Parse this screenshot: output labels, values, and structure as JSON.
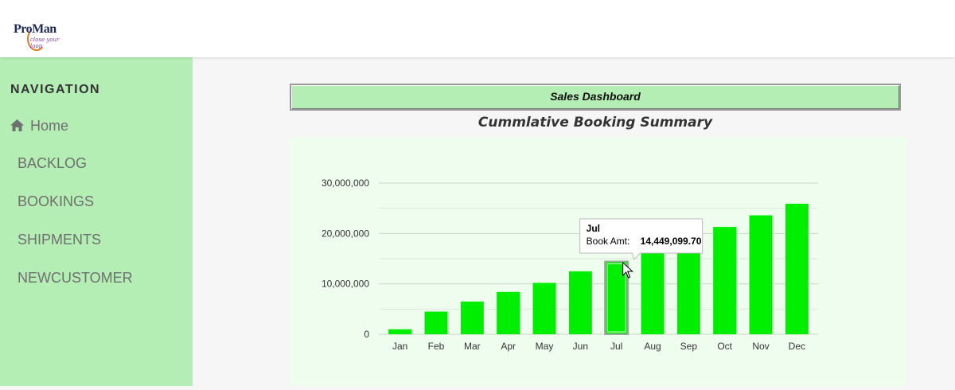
{
  "logo": {
    "name": "ProMan",
    "tagline": "close your loop"
  },
  "sidebar": {
    "title": "NAVIGATION",
    "items": [
      {
        "label": "Home",
        "icon": "home-icon"
      },
      {
        "label": "BACKLOG"
      },
      {
        "label": "BOOKINGS"
      },
      {
        "label": "SHIPMENTS"
      },
      {
        "label": "NEWCUSTOMER"
      }
    ]
  },
  "dashboard": {
    "header": "Sales Dashboard"
  },
  "chart_data": {
    "type": "bar",
    "title": "Cummlative Booking Summary",
    "categories": [
      "Jan",
      "Feb",
      "Mar",
      "Apr",
      "May",
      "Jun",
      "Jul",
      "Aug",
      "Sep",
      "Oct",
      "Nov",
      "Dec"
    ],
    "series": [
      {
        "name": "Book Amt",
        "values": [
          1000000,
          4500000,
          6500000,
          8400000,
          10200000,
          12500000,
          14449099.7,
          16400000,
          18500000,
          21300000,
          23600000,
          25900000
        ]
      }
    ],
    "yticks": [
      "0",
      "10,000,000",
      "20,000,000",
      "30,000,000"
    ],
    "ylim": [
      0,
      30000000
    ],
    "grid": true,
    "bar_color": "#00ee00",
    "tooltip": {
      "category": "Jul",
      "label": "Book Amt:",
      "value": "14,449,099.70"
    }
  },
  "colors": {
    "sidebar_bg": "#b4eeb4",
    "chart_bg": "#effdef",
    "bar": "#00ee00"
  }
}
